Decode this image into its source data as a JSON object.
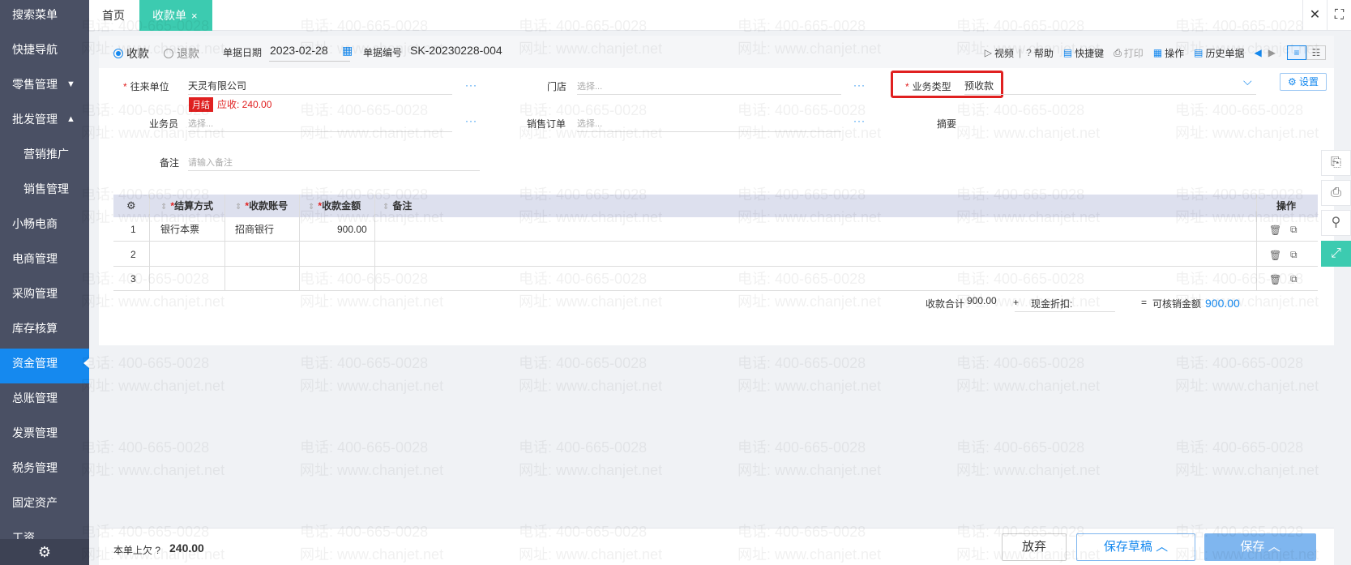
{
  "sidebar": {
    "items": [
      {
        "label": "搜索菜单"
      },
      {
        "label": "快捷导航"
      },
      {
        "label": "零售管理",
        "caret": "▼"
      },
      {
        "label": "批发管理",
        "caret": "▲"
      },
      {
        "label": "营销推广"
      },
      {
        "label": "销售管理"
      },
      {
        "label": "小畅电商"
      },
      {
        "label": "电商管理"
      },
      {
        "label": "采购管理"
      },
      {
        "label": "库存核算"
      },
      {
        "label": "资金管理"
      },
      {
        "label": "总账管理"
      },
      {
        "label": "发票管理"
      },
      {
        "label": "税务管理"
      },
      {
        "label": "固定资产"
      },
      {
        "label": "工资"
      }
    ],
    "active_index": 10
  },
  "tabs": {
    "home": "首页",
    "active": "收款单",
    "close": "×"
  },
  "window": {
    "close": "✕",
    "fullscreen": "⛶"
  },
  "header": {
    "radio_receive": "收款",
    "radio_refund": "退款",
    "date_label": "单据日期",
    "date_value": "2023-02-28",
    "no_label": "单据编号",
    "no_value": "SK-20230228-004"
  },
  "toolbar": {
    "video": "视频",
    "sep": "|",
    "help": "帮助",
    "shortcut": "快捷键",
    "print": "打印",
    "operate": "操作",
    "history": "历史单据"
  },
  "form": {
    "partner_label": "往来单位",
    "partner_value": "天灵有限公司",
    "credit_tag": "月结",
    "credit_amount": "应收: 240.00",
    "store_label": "门店",
    "store_placeholder": "选择...",
    "biz_type_label": "业务类型",
    "biz_type_value": "预收款",
    "settings": "设置",
    "salesman_label": "业务员",
    "salesman_placeholder": "选择...",
    "sales_order_label": "销售订单",
    "sales_order_placeholder": "选择...",
    "summary_label": "摘要",
    "remark_label": "备注",
    "remark_placeholder": "请输入备注",
    "dots": "···"
  },
  "table": {
    "headers": [
      "结算方式",
      "收款账号",
      "收款金额",
      "备注",
      "操作"
    ],
    "rows": [
      {
        "no": "1",
        "method": "银行本票",
        "account": "招商银行",
        "amount": "900.00"
      },
      {
        "no": "2",
        "method": "",
        "account": "",
        "amount": ""
      },
      {
        "no": "3",
        "method": "",
        "account": "",
        "amount": ""
      }
    ]
  },
  "totals": {
    "receive_label": "收款合计",
    "receive_value": "900.00",
    "plus": "+",
    "discount_label": "现金折扣:",
    "equals": "=",
    "writeoff_label": "可核销金额",
    "writeoff_value": "900.00"
  },
  "bottom": {
    "owe_label": "本单上欠",
    "owe_value": "240.00",
    "cancel": "放弃",
    "draft": "保存草稿",
    "save": "保存"
  },
  "watermark": {
    "phone": "电话: 400-665-0028",
    "site": "网址: www.chanjet.net"
  },
  "colors": {
    "sidebar_bg": "#4a5064",
    "active_blue": "#1589ef",
    "tab_teal": "#3ccbb0",
    "required_red": "#e02020",
    "table_head_bg": "#dde0ee"
  }
}
